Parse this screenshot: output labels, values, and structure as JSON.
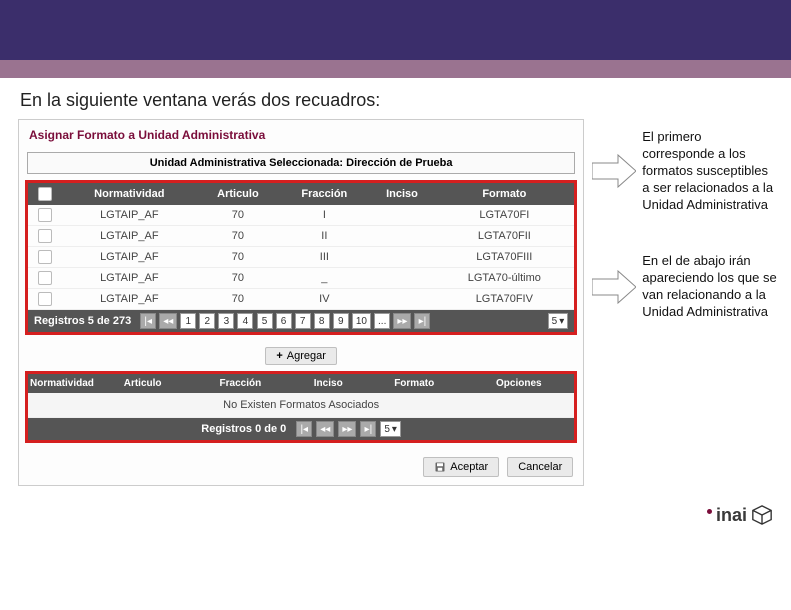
{
  "slide": {
    "intro_text": "En la siguiente ventana verás dos recuadros:"
  },
  "app": {
    "title": "Asignar Formato a Unidad Administrativa",
    "subtitle": "Unidad Administrativa Seleccionada: Dirección de Prueba"
  },
  "table1": {
    "headers": [
      "",
      "Normatividad",
      "Articulo",
      "Fracción",
      "Inciso",
      "Formato"
    ],
    "rows": [
      {
        "normatividad": "LGTAIP_AF",
        "articulo": "70",
        "fraccion": "I",
        "inciso": "",
        "formato": "LGTA70FI"
      },
      {
        "normatividad": "LGTAIP_AF",
        "articulo": "70",
        "fraccion": "II",
        "inciso": "",
        "formato": "LGTA70FII"
      },
      {
        "normatividad": "LGTAIP_AF",
        "articulo": "70",
        "fraccion": "III",
        "inciso": "",
        "formato": "LGTA70FIII"
      },
      {
        "normatividad": "LGTAIP_AF",
        "articulo": "70",
        "fraccion": "_",
        "inciso": "",
        "formato": "LGTA70-último"
      },
      {
        "normatividad": "LGTAIP_AF",
        "articulo": "70",
        "fraccion": "IV",
        "inciso": "",
        "formato": "LGTA70FIV"
      }
    ],
    "pager_label": "Registros 5 de 273",
    "pages": [
      "1",
      "2",
      "3",
      "4",
      "5",
      "6",
      "7",
      "8",
      "9",
      "10",
      "..."
    ],
    "page_size": "5"
  },
  "actions": {
    "agregar": "Agregar",
    "aceptar": "Aceptar",
    "cancelar": "Cancelar"
  },
  "table2": {
    "headers": [
      "Normatividad",
      "Articulo",
      "Fracción",
      "Inciso",
      "Formato",
      "Opciones"
    ],
    "empty_label": "No Existen Formatos Asociados",
    "pager_label": "Registros 0 de 0",
    "page_size": "5"
  },
  "annotations": {
    "note1": "El primero corresponde a los formatos susceptibles a ser relacionados a la Unidad Administrativa",
    "note2": "En el de abajo irán apareciendo los que se van relacionando a la Unidad Administrativa"
  },
  "brand": {
    "name": "inai"
  },
  "nav_icons": {
    "first": "|◂",
    "prev": "◂◂",
    "next": "▸▸",
    "last": "▸|",
    "dropdown": "▾"
  }
}
